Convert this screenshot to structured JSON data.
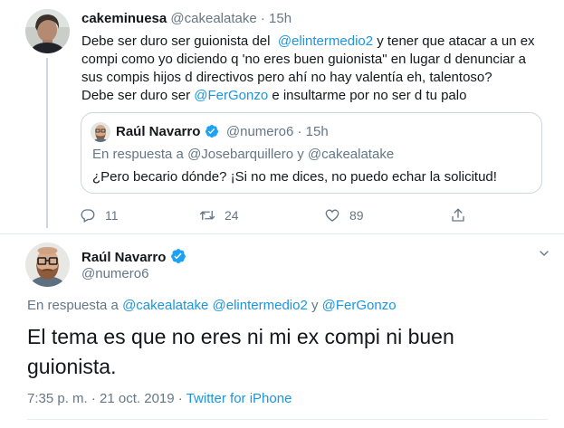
{
  "tweet": {
    "name": "cakeminuesa",
    "handle": "@cakealatake",
    "dot": "·",
    "time": "15h",
    "line1_a": "Debe ser duro ser guionista del",
    "line1_mention": "@elintermedio2",
    "line1_b": "y tener que atacar a un ex",
    "line2": "compi como yo diciendo q 'no eres buen guionista\" en lugar d denunciar a",
    "line3": "sus compis hijos d directivos pero ahí no hay valentía eh, talentoso?",
    "line4_a": "Debe ser duro ser",
    "line4_mention": "@FerGonzo",
    "line4_b": "e insultarme por no ser d tu palo",
    "quote": {
      "name": "Raúl Navarro",
      "handle": "@numero6",
      "dot": "·",
      "time": "15h",
      "reply_prefix": "En respuesta a",
      "reply_user1": "@Josebarquillero",
      "reply_and": "y",
      "reply_user2": "@cakealatake",
      "text": "¿Pero becario dónde? ¡Si no me dices, no puedo echar la solicitud!"
    },
    "actions": {
      "replies": "11",
      "retweets": "24",
      "likes": "89"
    }
  },
  "main": {
    "name": "Raúl Navarro",
    "handle": "@numero6",
    "reply_prefix": "En respuesta a",
    "reply_user1": "@cakealatake",
    "reply_user2": "@elintermedio2",
    "reply_and": "y",
    "reply_user3": "@FerGonzo",
    "text": "El tema es que no eres ni mi ex compi ni buen guionista.",
    "time": "7:35 p. m.",
    "dot": "·",
    "date": "21 oct. 2019",
    "source": "Twitter for iPhone"
  },
  "colors": {
    "link": "#1b95e0",
    "secondary": "#657786",
    "verified": "#1da1f2",
    "border": "#ccd6dd"
  }
}
